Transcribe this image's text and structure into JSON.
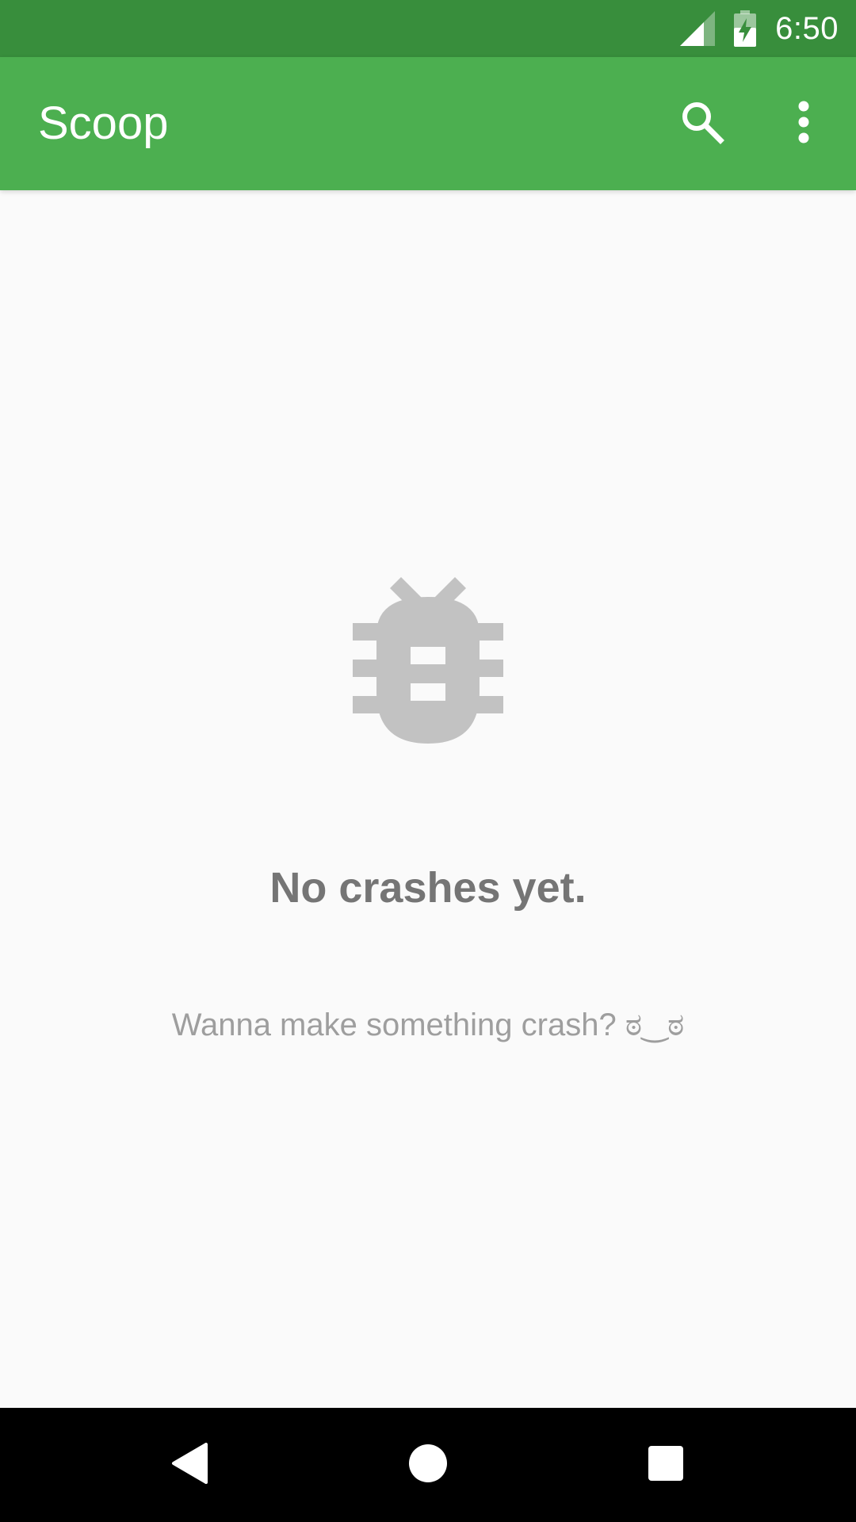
{
  "status_bar": {
    "time": "6:50",
    "icons": [
      "signal-icon",
      "battery-charging-icon"
    ]
  },
  "app_bar": {
    "title": "Scoop",
    "actions": [
      "search-icon",
      "more-vert-icon"
    ]
  },
  "empty_state": {
    "icon": "bug-icon",
    "title": "No crashes yet.",
    "subtitle": "Wanna make something crash? ಠ‿ಠ"
  },
  "navigation_bar": {
    "buttons": [
      "back-icon",
      "home-icon",
      "recents-icon"
    ]
  },
  "colors": {
    "status_bar": "#388e3c",
    "app_bar": "#4caf50",
    "background": "#fafafa",
    "bug_icon": "#c2c2c2",
    "title_text": "#757575",
    "subtitle_text": "#9e9e9e"
  }
}
